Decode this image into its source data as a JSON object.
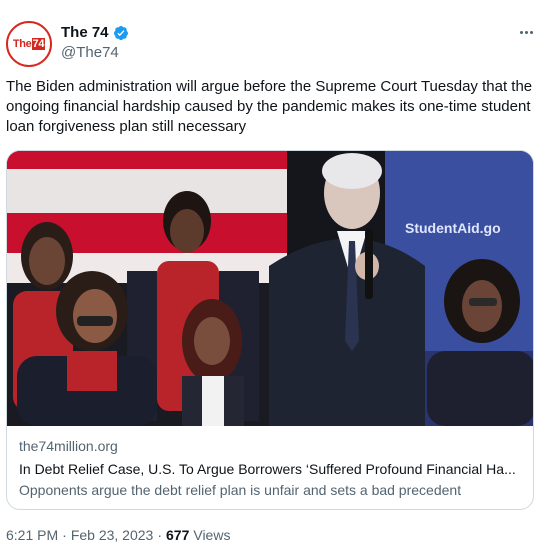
{
  "author": {
    "display_name": "The 74",
    "handle": "@The74",
    "avatar_text_a": "The",
    "avatar_text_b": "74"
  },
  "tweet": {
    "text": "The Biden administration will argue before the Supreme Court Tuesday that the ongoing financial hardship caused by the pandemic makes its one-time student loan forgiveness plan still necessary"
  },
  "card": {
    "image_sign_text": "StudentAid.go",
    "domain": "the74million.org",
    "title": "In Debt Relief Case, U.S. To Argue Borrowers ‘Suffered Profound Financial Ha...",
    "description": "Opponents argue the debt relief plan is unfair and sets a bad precedent"
  },
  "footer": {
    "time": "6:21 PM",
    "separator": "·",
    "date": "Feb 23, 2023",
    "separator2": "·",
    "views_count": "677",
    "views_label": "Views"
  },
  "colors": {
    "brand_red": "#d6281e",
    "verified_blue": "#1d9bf0",
    "muted_text": "#536471",
    "border": "#cfd9de"
  },
  "icons": {
    "verified": "verified-badge-icon",
    "more": "more-options-icon"
  }
}
